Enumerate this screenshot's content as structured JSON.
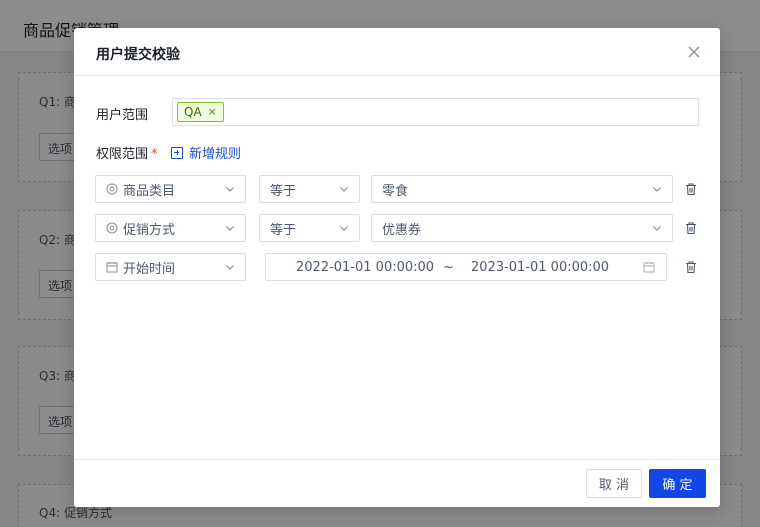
{
  "background": {
    "page_title": "商品促销管理",
    "sections": [
      {
        "question": "Q1: 商",
        "option": "选项"
      },
      {
        "question": "Q2: 商",
        "option": "选项"
      },
      {
        "question": "Q3: 商",
        "option": "选项"
      },
      {
        "question": "Q4: 促销方式"
      }
    ]
  },
  "modal": {
    "title": "用户提交校验",
    "user_scope": {
      "label": "用户范围",
      "tags": [
        "QA"
      ],
      "tag_remove": "×"
    },
    "permission_scope": {
      "label": "权限范围",
      "required_mark": "*",
      "add_rule_label": "新增规则"
    },
    "rules": [
      {
        "field": "商品类目",
        "operator": "等于",
        "value": "零食"
      },
      {
        "field": "促销方式",
        "operator": "等于",
        "value": "优惠券"
      },
      {
        "field": "开始时间",
        "range_start": "2022-01-01 00:00:00",
        "range_separator": "~",
        "range_end": "2023-01-01 00:00:00"
      }
    ],
    "footer": {
      "cancel_label": "取 消",
      "ok_label": "确 定"
    }
  },
  "colors": {
    "primary": "#1246e6",
    "tag_border": "#7cc61f",
    "tag_bg": "#f0fae0",
    "required": "#f53f3f"
  }
}
